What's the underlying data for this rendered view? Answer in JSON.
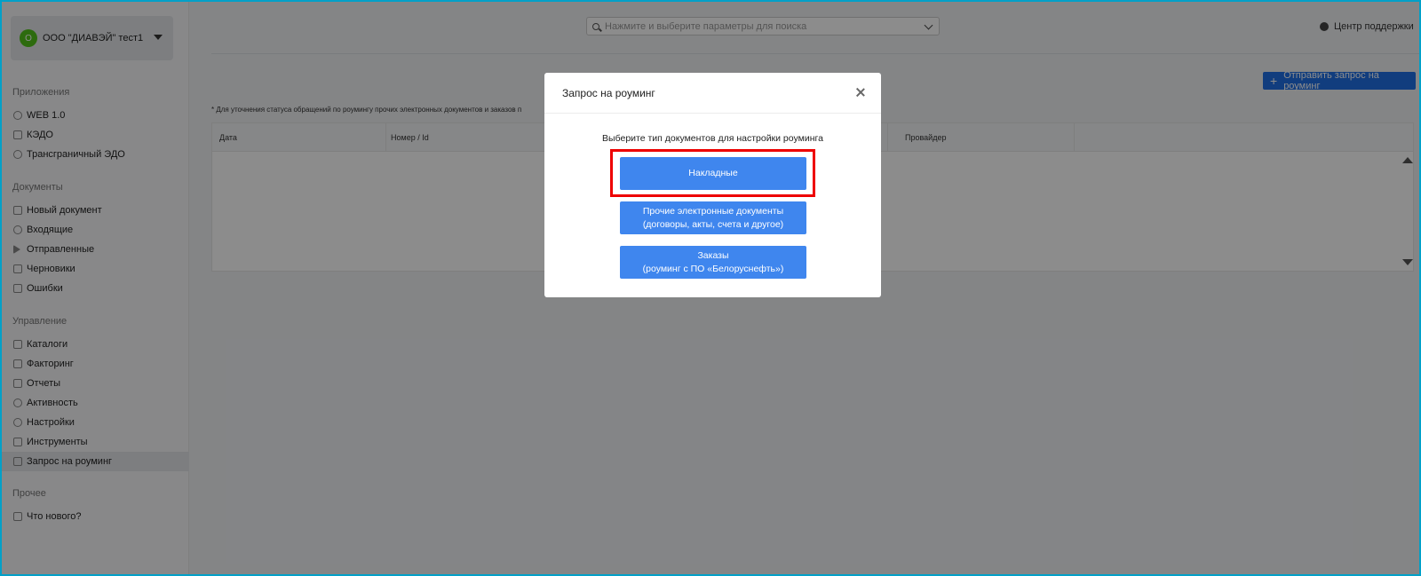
{
  "sidebar": {
    "org": {
      "avatar_letter": "О",
      "name": "ООО \"ДИАВЭЙ\" тест1"
    },
    "sections": {
      "apps": "Приложения",
      "documents": "Документы",
      "management": "Управление",
      "other": "Прочее"
    },
    "apps_items": [
      "WEB 1.0",
      "КЭДО",
      "Трансграничный ЭДО"
    ],
    "document_items": [
      "Новый документ",
      "Входящие",
      "Отправленные",
      "Черновики",
      "Ошибки"
    ],
    "management_items": [
      "Каталоги",
      "Факторинг",
      "Отчеты",
      "Активность",
      "Настройки",
      "Инструменты",
      "Запрос на роуминг"
    ],
    "other_items": [
      "Что нового?"
    ]
  },
  "header": {
    "search_placeholder": "Нажмите и выберите параметры для поиска",
    "support_label": "Центр поддержки"
  },
  "toolbar": {
    "send_request_label": "Отправить запрос на роуминг"
  },
  "note": "* Для уточнения статуса обращений по роумингу прочих электронных документов и заказов п",
  "table": {
    "columns": [
      "Дата",
      "Номер / Id",
      "Провайдер"
    ]
  },
  "modal": {
    "title": "Запрос на роуминг",
    "prompt": "Выберите тип документов для настройки роуминга",
    "options": [
      {
        "line1": "Накладные",
        "line2": ""
      },
      {
        "line1": "Прочие электронные документы",
        "line2": "(договоры, акты, счета и другое)"
      },
      {
        "line1": "Заказы",
        "line2": "(роуминг с ПО «Белоруснефть»)"
      }
    ]
  },
  "colors": {
    "accent": "#3f86ee",
    "highlight": "#ee0000",
    "frame": "#00a0c8"
  }
}
